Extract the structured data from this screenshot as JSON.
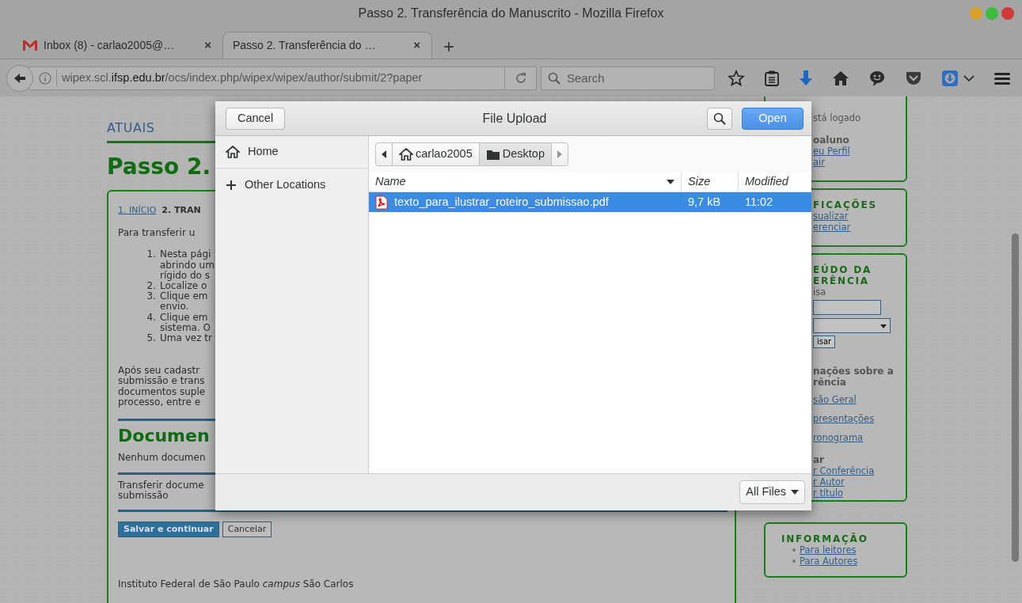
{
  "window": {
    "title": "Passo 2. Transferência do Manuscrito - Mozilla Firefox"
  },
  "window_controls": [
    {
      "color": "#d9a12a"
    },
    {
      "color": "#3dbd3d"
    },
    {
      "color": "#d23a3a"
    }
  ],
  "tabs": [
    {
      "label": "Inbox (8) - carlao2005@…",
      "kind": "mail",
      "close": "×",
      "selected": false
    },
    {
      "label": "Passo 2. Transferência do …",
      "kind": "page",
      "close": "×",
      "selected": true
    }
  ],
  "new_tab": "+",
  "toolbar": {
    "url": "wipex.scl.**ifsp.edu.br**/ocs/index.php/wipex/wipex/author/submit/2?paper",
    "search_placeholder": "Search"
  },
  "page": {
    "nav": [
      "ATUAIS"
    ],
    "heading": "Passo 2.",
    "breadcrumb": [
      {
        "label": "1. INÍCIO",
        "kind": "link"
      },
      {
        "label": "2. TRAN",
        "kind": "current"
      }
    ],
    "intro": "Para transferir u",
    "steps": [
      {
        "number": "1.",
        "lines": [
          "Nesta pági",
          "abrindo um",
          "rígido do s"
        ]
      },
      {
        "number": "2.",
        "lines": [
          "Localize o"
        ]
      },
      {
        "number": "3.",
        "lines": [
          "Clique em",
          "envio."
        ]
      },
      {
        "number": "4.",
        "lines": [
          "Clique em",
          "sistema. O"
        ]
      },
      {
        "number": "5.",
        "lines": [
          "Uma vez tr"
        ]
      }
    ],
    "paragraph": [
      "Após seu cadastr",
      "submissão e trans",
      "documentos suple",
      "processo, entre e"
    ],
    "documents_heading": "Documen",
    "documents_empty": "Nenhum documen",
    "upload_label": [
      "Transferir docume",
      "submissão"
    ],
    "buttons": [
      {
        "label": "Salvar e continuar",
        "kind": "primary"
      },
      {
        "label": "Cancelar",
        "kind": "secondary"
      }
    ],
    "footer": [
      "Instituto Federal de São Paulo *campus* São Carlos"
    ]
  },
  "sidebar": [
    {
      "items": [
        {
          "kind": "muted",
          "text": "stá logado"
        },
        {
          "kind": "strong",
          "text": "oaluno"
        },
        {
          "kind": "link",
          "text": "eu Perfil"
        },
        {
          "kind": "link",
          "text": "air"
        }
      ]
    },
    {
      "items": [
        {
          "kind": "heading",
          "text": "FICAÇÕES"
        },
        {
          "kind": "link",
          "text": "sualizar"
        },
        {
          "kind": "link",
          "text": "erenciar"
        }
      ]
    },
    {
      "items": [
        {
          "kind": "heading",
          "text": "EÚDO DA"
        },
        {
          "kind": "heading",
          "text": "ERÊNCIA"
        },
        {
          "kind": "muted",
          "text": "isa"
        },
        {
          "kind": "input"
        },
        {
          "kind": "select"
        },
        {
          "kind": "button",
          "text": "isar"
        },
        {
          "kind": "strong",
          "text": "nações sobre a"
        },
        {
          "kind": "strong",
          "text": "rência"
        },
        {
          "kind": "link",
          "text": "são Geral"
        },
        {
          "kind": "link",
          "text": "presentações"
        },
        {
          "kind": "link",
          "text": "ronograma"
        },
        {
          "kind": "strong",
          "text": "ar"
        },
        {
          "kind": "link",
          "text": "r Conferência"
        },
        {
          "kind": "link",
          "text": "r Autor"
        },
        {
          "kind": "link",
          "text": "r título"
        }
      ]
    },
    {
      "items": [
        {
          "kind": "heading",
          "text": "INFORMAÇÃO"
        },
        {
          "kind": "bullet",
          "text": "Para leitores"
        },
        {
          "kind": "bullet",
          "text": "Para Autores"
        }
      ]
    }
  ],
  "dialog": {
    "title": "File Upload",
    "cancel": "Cancel",
    "open": "Open",
    "places": [
      {
        "label": "Home",
        "kind": "home",
        "selected": false
      },
      {
        "label": "Other Locations",
        "kind": "other",
        "selected": false
      }
    ],
    "path": [
      {
        "label": "carlao2005",
        "kind": "home",
        "selected": false
      },
      {
        "label": "Desktop",
        "kind": "folder",
        "selected": true
      }
    ],
    "columns": [
      {
        "label": "Name",
        "sorted": true
      },
      {
        "label": "Size",
        "sorted": false
      },
      {
        "label": "Modified",
        "sorted": false
      }
    ],
    "files": [
      {
        "name": "texto_para_ilustrar_roteiro_submissao.pdf",
        "size": "9,7 kB",
        "modified": "11:02",
        "selected": true
      }
    ],
    "filter": "All Files"
  }
}
